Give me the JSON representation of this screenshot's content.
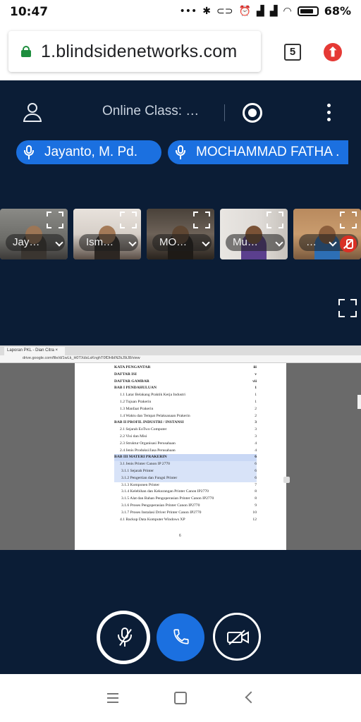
{
  "status_bar": {
    "time": "10:47",
    "battery": "68%",
    "icons": [
      "more-dots-icon",
      "bluetooth-icon",
      "toggle-icon",
      "alarm-icon",
      "signal-icon",
      "signal-icon",
      "wifi-icon",
      "battery-icon"
    ]
  },
  "browser": {
    "url": "1.blindsidenetworks.com",
    "tab_count": "5"
  },
  "header": {
    "meeting_title": "Online Class: …"
  },
  "talkers": [
    {
      "name": "Jayanto, M. Pd."
    },
    {
      "name": "MOCHAMMAD FATHA ."
    }
  ],
  "participants": [
    {
      "name": "Jay…",
      "muted": false
    },
    {
      "name": "Ism…",
      "muted": false
    },
    {
      "name": "MO…",
      "muted": false
    },
    {
      "name": "Mu…",
      "muted": false
    },
    {
      "name": "…",
      "muted": true
    }
  ],
  "presentation": {
    "browser_tab": "Laporan PKL - Dian Citra ×",
    "doc_url": "drive.google.com/file/d/1wLk_H0TXdsLsKnghT0fDHbIN2kJ9iJ8/view",
    "page_footer": "6",
    "toc": [
      {
        "label": "KATA PENGANTAR",
        "page": "iii",
        "style": "bold"
      },
      {
        "label": "DAFTAR ISI",
        "page": "v",
        "style": "bold"
      },
      {
        "label": "DAFTAR GAMBAR",
        "page": "vii",
        "style": "bold"
      },
      {
        "label": "BAB I PENDAHULUAN",
        "page": "1",
        "style": "bold"
      },
      {
        "label": "1.1    Latar Belakang Praktik Kerja Industri",
        "page": "1",
        "style": "sub1"
      },
      {
        "label": "1.2    Tujuan Prakerin",
        "page": "1",
        "style": "sub1"
      },
      {
        "label": "1.3    Manfaat Prakerin",
        "page": "2",
        "style": "sub1"
      },
      {
        "label": "1.4    Waktu dan Tempat Pelaksanaan Prakerin",
        "page": "2",
        "style": "sub1"
      },
      {
        "label": "BAB II PROFIL INDUSTRI / INSTANSI",
        "page": "3",
        "style": "bold"
      },
      {
        "label": "2.1    Sejarah EoTwo Computer",
        "page": "3",
        "style": "sub1"
      },
      {
        "label": "2.2    Visi dan Misi",
        "page": "3",
        "style": "sub1"
      },
      {
        "label": "2.3    Struktur Organisasi Perusahaan",
        "page": "4",
        "style": "sub1"
      },
      {
        "label": "2.4    Jenis Produksi/Jasa Perusahaan",
        "page": "4",
        "style": "sub1"
      },
      {
        "label": "BAB III MATERI PRAKERIN",
        "page": "6",
        "style": "bold hl"
      },
      {
        "label": "3.1    Jenis Printer Canon IP 2770",
        "page": "6",
        "style": "sub1 hl2"
      },
      {
        "label": "3.1.1   Sejarah Printer",
        "page": "6",
        "style": "sub2 hl2"
      },
      {
        "label": "3.1.2   Pengertian dan Fungsi Printer",
        "page": "6",
        "style": "sub2 hl2"
      },
      {
        "label": "3.1.3   Komponen Printer",
        "page": "7",
        "style": "sub2"
      },
      {
        "label": "3.1.4   Kelebihan dan Kekurangan Printer Canon IP2770",
        "page": "8",
        "style": "sub2"
      },
      {
        "label": "3.1.5   Alat dan Bahan Pengoperasian Printer Canon IP2770",
        "page": "8",
        "style": "sub2"
      },
      {
        "label": "3.1.6   Proses Pengoperasian Printer Canon IP2770",
        "page": "9",
        "style": "sub2"
      },
      {
        "label": "3.1.7   Proses Instalasi Driver Printer Canon IP2770",
        "page": "10",
        "style": "sub2"
      },
      {
        "label": "4.1    Backup Data Komputer Windows XP",
        "page": "12",
        "style": "sub1"
      }
    ]
  },
  "colors": {
    "background": "#0b1d36",
    "accent": "#1b70e0",
    "muted_red": "#d93025",
    "secure_green": "#1e8e3e"
  }
}
